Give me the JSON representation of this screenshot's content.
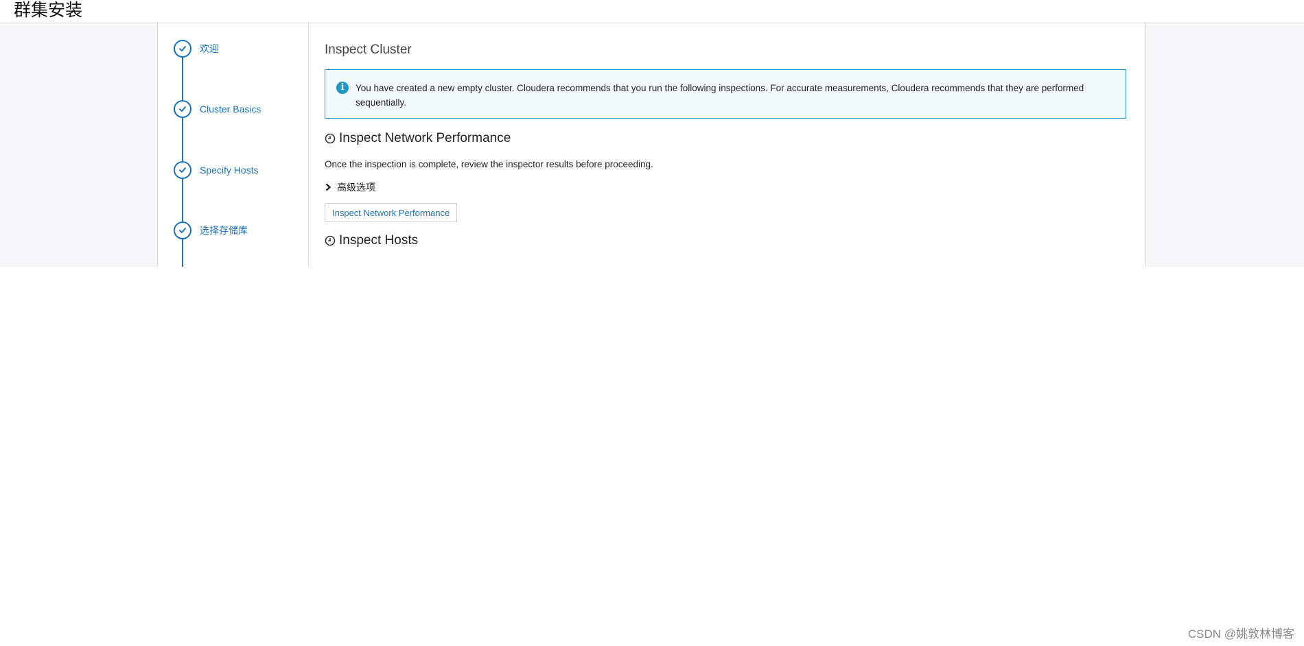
{
  "app": {
    "title": "群集安装"
  },
  "steps": [
    {
      "label": "欢迎"
    },
    {
      "label": "Cluster Basics"
    },
    {
      "label": "Specify Hosts"
    },
    {
      "label": "选择存储库"
    }
  ],
  "main": {
    "title": "Inspect Cluster",
    "alert": {
      "icon": "info-icon",
      "text": "You have created a new empty cluster. Cloudera recommends that you run the following inspections. For accurate measurements, Cloudera recommends that they are performed sequentially."
    },
    "network": {
      "heading": "Inspect Network Performance",
      "description": "Once the inspection is complete, review the inspector results before proceeding.",
      "advanced_label": "高级选项",
      "button_label": "Inspect Network Performance"
    },
    "hosts": {
      "heading": "Inspect Hosts"
    }
  },
  "watermark": "CSDN @姚敦林博客",
  "colors": {
    "accent": "#1d74b8",
    "alert_border": "#1f98c8",
    "alert_bg": "#f2f9fc"
  }
}
